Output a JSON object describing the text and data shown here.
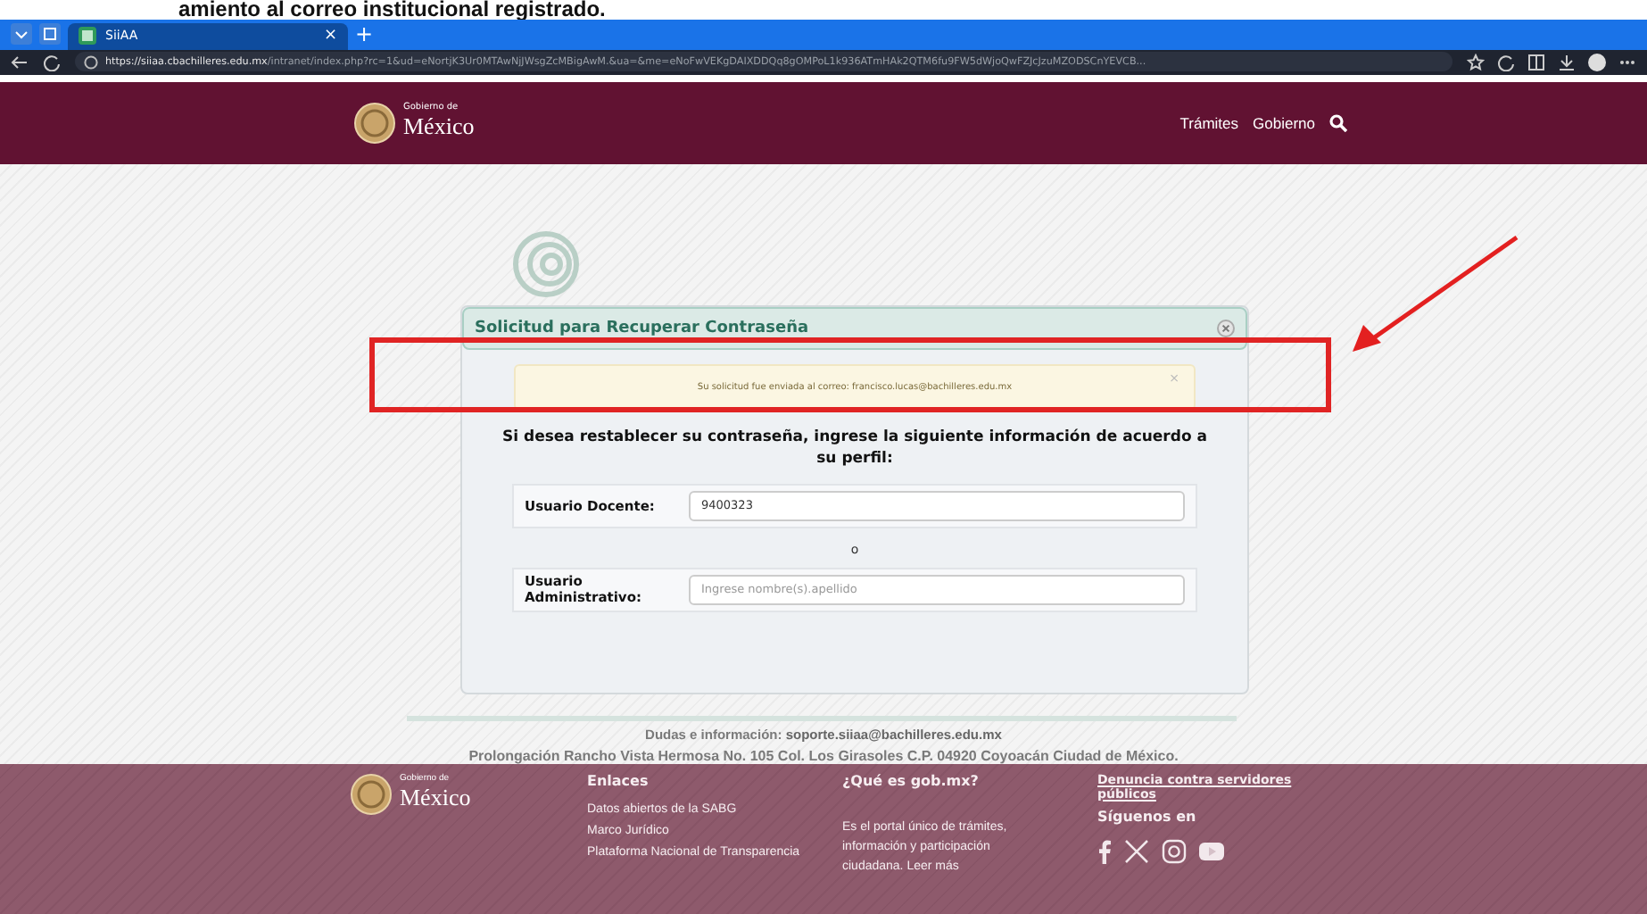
{
  "top_caption": "amiento al correo institucional registrado.",
  "browser": {
    "tab": {
      "title": "SiiAA",
      "close": "×"
    },
    "new_tab": "+",
    "url_host": "https://siiaa.cbachilleres.edu.mx",
    "url_path": "/intranet/index.php?rc=1&ud=eNortjK3Ur0MTAwNjJWsgZcMBigAwM.&ua=&me=eNoFwVEKgDAIXDDQq8gOMPoL1k936ATmHAk2QTM6fu9FW5dWjoQwFZJcJzuMZODSCnYEVCB..."
  },
  "header": {
    "logo_small": "Gobierno de",
    "logo_big": "México",
    "nav": [
      "Trámites",
      "Gobierno"
    ]
  },
  "modal": {
    "title": "Solicitud para Recuperar Contraseña",
    "alert": {
      "message": "Su solicitud fue enviada al correo: francisco.lucas@bachilleres.edu.mx",
      "close": "×"
    },
    "instruction": "Si desea restablecer su contraseña, ingrese la siguiente información de acuerdo a su perfil:",
    "fields": [
      {
        "label": "Usuario Docente:",
        "value": "9400323"
      },
      {
        "label": "Usuario Administrativo:",
        "placeholder": "Ingrese nombre(s).apellido"
      }
    ],
    "separator": "o"
  },
  "contact": {
    "line": "Dudas e información: **soporte.siiaa@bachilleres.edu.mx**",
    "address": "Prolongación Rancho Vista Hermosa No. 105 Col. Los Girasoles C.P. 04920 Coyoacán Ciudad de México."
  },
  "footer": {
    "logo_small": "Gobierno de",
    "logo_big": "México",
    "links": {
      "title": "Enlaces",
      "items": [
        "Datos abiertos de la SABG",
        "Marco Jurídico",
        "Plataforma Nacional de Transparencia"
      ]
    },
    "about": {
      "title": "¿Qué es gob.mx?",
      "text": "Es el portal único de trámites, información y participación ciudadana. Leer más"
    },
    "report_link": "Denuncia contra servidores públicos",
    "follow_title": "Síguenos en"
  }
}
